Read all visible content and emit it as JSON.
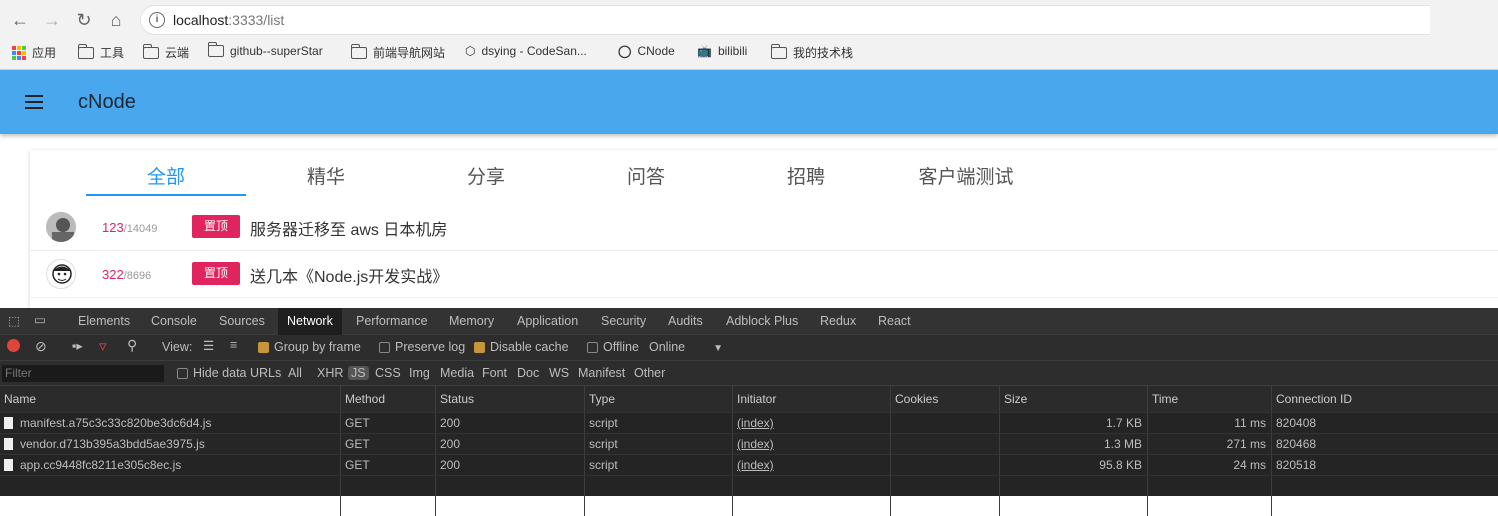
{
  "browser": {
    "url_host": "localhost",
    "url_port_path": ":3333/list",
    "bookmarks": [
      "应用",
      "工具",
      "云端",
      "github--superStar",
      "前端导航网站",
      "dsying - CodeSan...",
      "CNode",
      "bilibili",
      "我的技术栈"
    ]
  },
  "app": {
    "brand": "cNode",
    "tabs": [
      "全部",
      "精华",
      "分享",
      "问答",
      "招聘",
      "客户端测试"
    ],
    "topics": [
      {
        "reply": "123",
        "visit": "14049",
        "pin": "置顶",
        "title": "服务器迁移至 aws 日本机房"
      },
      {
        "reply": "322",
        "visit": "8696",
        "pin": "置顶",
        "title": "送几本《Node.js开发实战》"
      }
    ]
  },
  "devtools": {
    "tabs": [
      "Elements",
      "Console",
      "Sources",
      "Network",
      "Performance",
      "Memory",
      "Application",
      "Security",
      "Audits",
      "Adblock Plus",
      "Redux",
      "React"
    ],
    "active_tab": "Network",
    "controls": {
      "view": "View:",
      "group": "Group by frame",
      "preserve": "Preserve log",
      "disable": "Disable cache",
      "offline": "Offline",
      "online": "Online"
    },
    "filter": {
      "placeholder": "Filter",
      "hide": "Hide data URLs",
      "types": [
        "All",
        "XHR",
        "JS",
        "CSS",
        "Img",
        "Media",
        "Font",
        "Doc",
        "WS",
        "Manifest",
        "Other"
      ]
    },
    "columns": [
      "Name",
      "Method",
      "Status",
      "Type",
      "Initiator",
      "Cookies",
      "Size",
      "Time",
      "Connection ID"
    ],
    "rows": [
      {
        "name": "manifest.a75c3c33c820be3dc6d4.js",
        "method": "GET",
        "status": "200",
        "type": "script",
        "initiator": "(index)",
        "cookies": "",
        "size": "1.7 KB",
        "time": "11 ms",
        "conn": "820408"
      },
      {
        "name": "vendor.d713b395a3bdd5ae3975.js",
        "method": "GET",
        "status": "200",
        "type": "script",
        "initiator": "(index)",
        "cookies": "",
        "size": "1.3 MB",
        "time": "271 ms",
        "conn": "820468"
      },
      {
        "name": "app.cc9448fc8211e305c8ec.js",
        "method": "GET",
        "status": "200",
        "type": "script",
        "initiator": "(index)",
        "cookies": "",
        "size": "95.8 KB",
        "time": "24 ms",
        "conn": "820518"
      }
    ]
  }
}
